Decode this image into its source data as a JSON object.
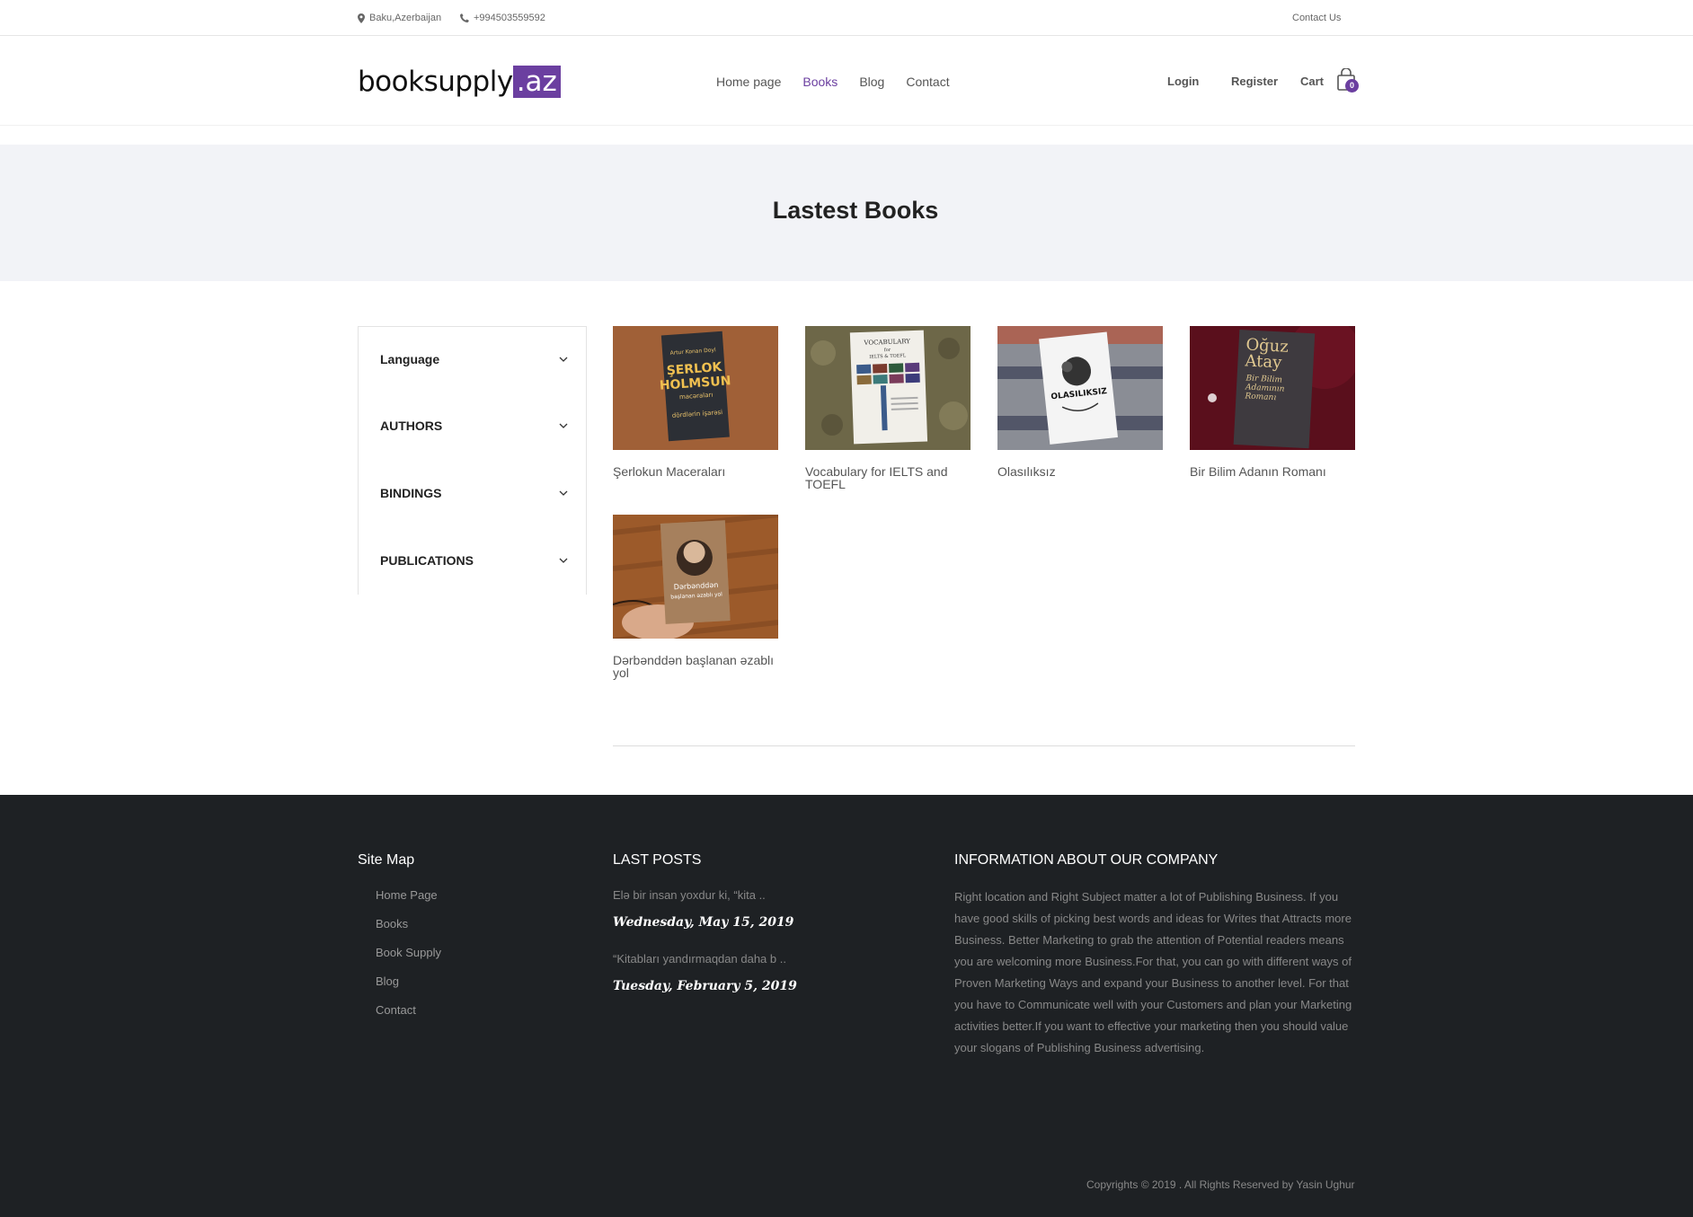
{
  "topbar": {
    "location": "Baku,Azerbaijan",
    "phone": "+994503559592",
    "contact_link": "Contact Us"
  },
  "header": {
    "logo_main": "booksupply",
    "logo_ext": ".az",
    "nav": [
      "Home page",
      "Books",
      "Blog",
      "Contact"
    ],
    "active_nav": "Books",
    "login": "Login",
    "register": "Register",
    "cart": "Cart",
    "cart_count": "0"
  },
  "banner": {
    "title": "Lastest Books"
  },
  "filters": [
    "Language",
    "AUTHORS",
    "BINDINGS",
    "PUBLICATIONS"
  ],
  "books": [
    {
      "title": "Şerlokun Macerаları",
      "cover_text": [
        "Artur Konan Doyl",
        "ŞERLOK",
        "HOLMSUN",
        "macəraları",
        "dördlərin işarəsi"
      ]
    },
    {
      "title": "Vocabulary for IELTS and TOEFL",
      "cover_text": [
        "VOCABULARY",
        "for",
        "IELTS & TOEFL"
      ]
    },
    {
      "title": "Olasılıksız",
      "cover_text": [
        "OLASILIKSIZ"
      ]
    },
    {
      "title": "Bir Bilim Adanın Romanı",
      "cover_text": [
        "Oğuz",
        "Atay",
        "Bir Bilim",
        "Adamının",
        "Romanı"
      ]
    },
    {
      "title": "Dərbənddən başlanan əzablı yol",
      "cover_text": [
        "Dərbənddən",
        "başlanan əzablı yol"
      ]
    }
  ],
  "footer": {
    "sitemap_title": "Site Map",
    "sitemap": [
      "Home Page",
      "Books",
      "Book Supply",
      "Blog",
      "Contact"
    ],
    "posts_title": "LAST POSTS",
    "posts": [
      {
        "excerpt": "Elə bir insan yoxdur ki, “kita ..",
        "date": "Wednesday, May 15, 2019"
      },
      {
        "excerpt": "“Kitabları yandırmaqdan daha b ..",
        "date": "Tuesday, February 5, 2019"
      }
    ],
    "info_title": "INFORMATION ABOUT OUR COMPANY",
    "info_text": "Right location and Right Subject matter a lot of Publishing Business. If you have good skills of picking best words and ideas for Writes that Attracts more Business. Better Marketing to grab the attention of Potential readers means you are welcoming more Business.For that, you can go with different ways of Proven Marketing Ways and expand your Business to another level. For that you have to Communicate well with your Customers and plan your Marketing activities better.If you want to effective your marketing then you should value your slogans of Publishing Business advertising.",
    "copyright": "Copyrights © 2019 . All Rights Reserved by Yasin Ughur"
  },
  "colors": {
    "accent": "#6b3fa0",
    "banner_bg": "#f2f3f7",
    "footer_bg": "#1e2124"
  }
}
